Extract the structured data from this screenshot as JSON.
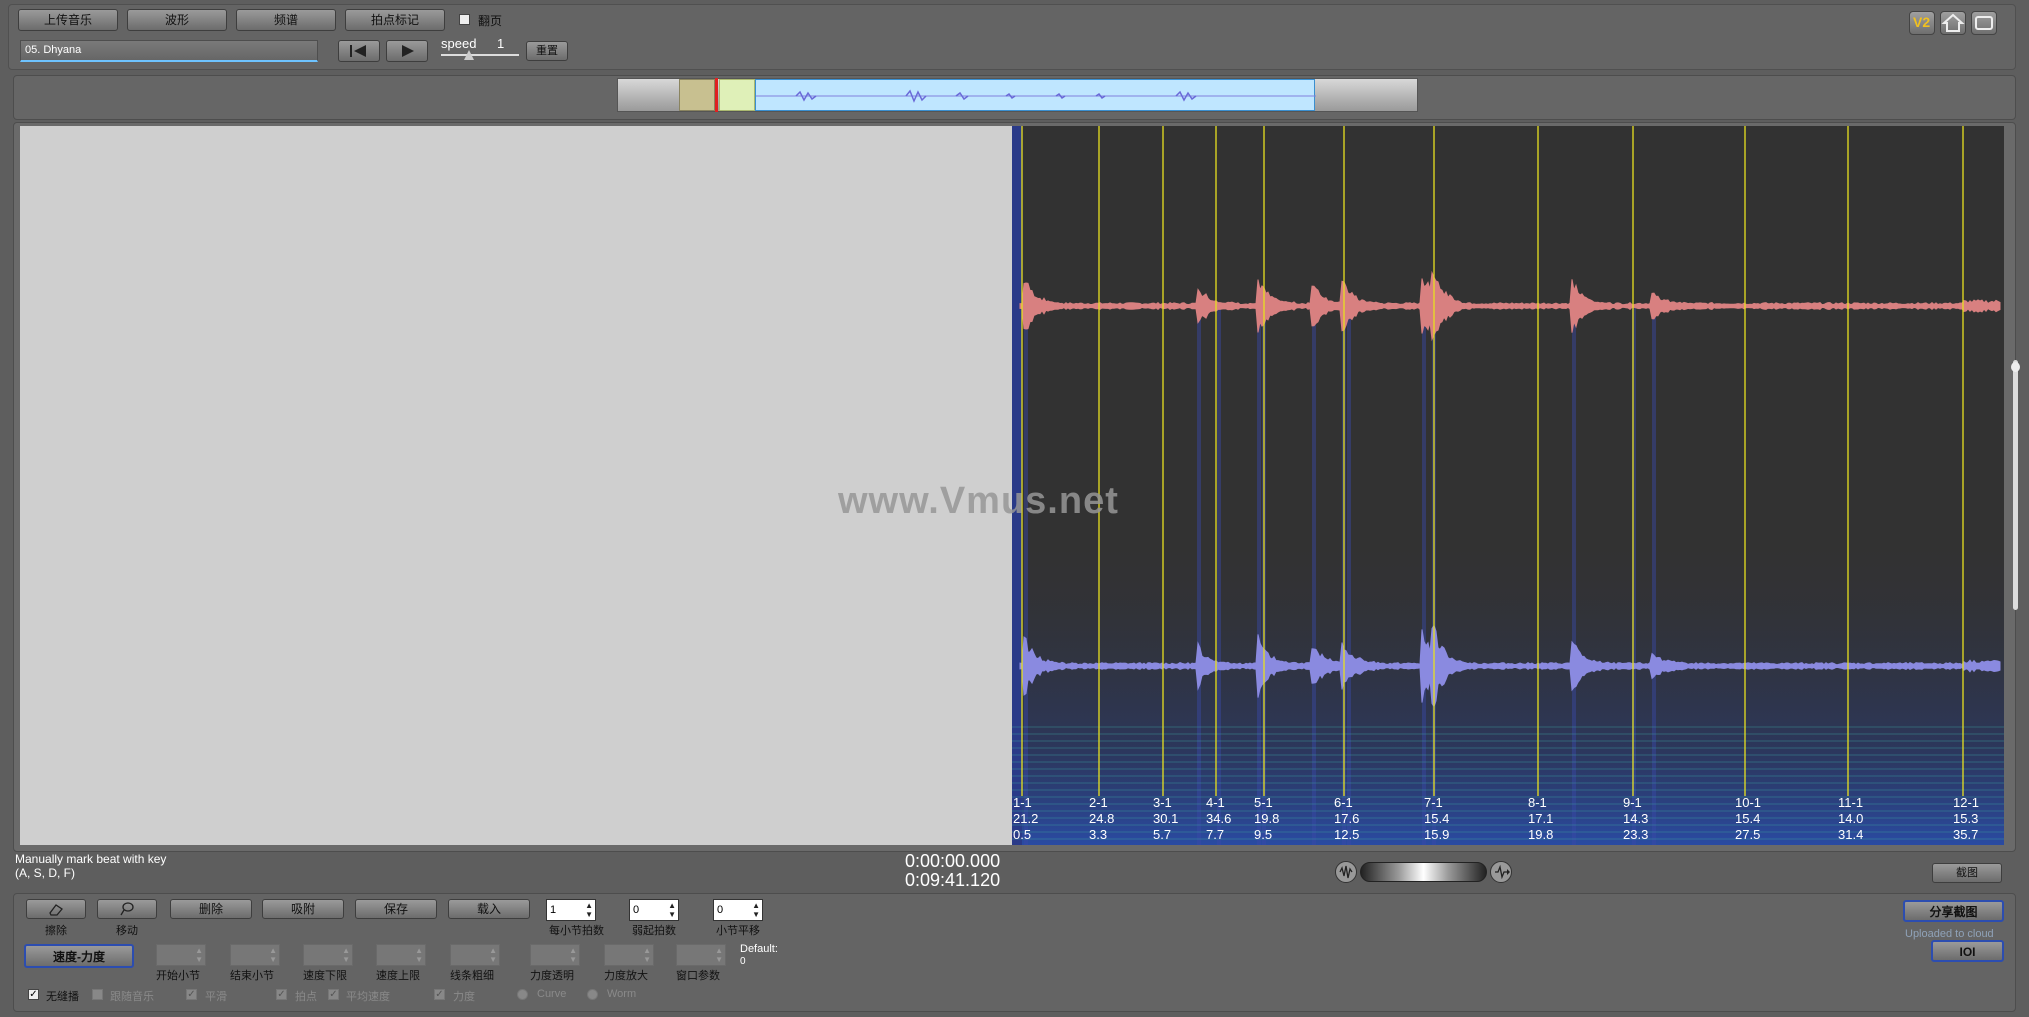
{
  "toolbar": {
    "upload_music": "上传音乐",
    "waveform": "波形",
    "spectrum": "频谱",
    "beat_mark": "拍点标记",
    "page_turn_label": "翻页",
    "track_name": "05. Dhyana",
    "speed_label": "speed",
    "speed_value": "1",
    "reset": "重置"
  },
  "top_right_icons": [
    "v2-icon",
    "home-icon",
    "window-icon"
  ],
  "top_right_v2": "V2",
  "main": {
    "watermark": "www.Vmus.net",
    "markers": [
      {
        "bar": "1-1",
        "tempo": "21.2",
        "time": "0.5"
      },
      {
        "bar": "2-1",
        "tempo": "24.8",
        "time": "3.3"
      },
      {
        "bar": "3-1",
        "tempo": "30.1",
        "time": "5.7"
      },
      {
        "bar": "4-1",
        "tempo": "34.6",
        "time": "7.7"
      },
      {
        "bar": "5-1",
        "tempo": "19.8",
        "time": "9.5"
      },
      {
        "bar": "6-1",
        "tempo": "17.6",
        "time": "12.5"
      },
      {
        "bar": "7-1",
        "tempo": "15.4",
        "time": "15.9"
      },
      {
        "bar": "8-1",
        "tempo": "17.1",
        "time": "19.8"
      },
      {
        "bar": "9-1",
        "tempo": "14.3",
        "time": "23.3"
      },
      {
        "bar": "10-1",
        "tempo": "15.4",
        "time": "27.5"
      },
      {
        "bar": "11-1",
        "tempo": "14.0",
        "time": "31.4"
      },
      {
        "bar": "12-1",
        "tempo": "15.3",
        "time": "35.7"
      }
    ]
  },
  "status": {
    "hint_line1": "Manually mark beat with key",
    "hint_line2": "(A, S, D, F)",
    "current_time": "0:00:00.000",
    "total_time": "0:09:41.120",
    "screenshot": "截图"
  },
  "bottom": {
    "erase_label": "擦除",
    "move_label": "移动",
    "delete": "删除",
    "snap": "吸附",
    "save": "保存",
    "load": "载入",
    "beats_per_bar_label": "每小节拍数",
    "beats_per_bar_value": "1",
    "pickup_beats_label": "弱起拍数",
    "pickup_beats_value": "0",
    "bar_shift_label": "小节平移",
    "bar_shift_value": "0",
    "tempo_dynamics": "速度-力度",
    "start_bar": "开始小节",
    "end_bar": "结束小节",
    "tempo_lower": "速度下限",
    "tempo_upper": "速度上限",
    "line_thickness": "线条粗细",
    "dynamics_transparency": "力度透明",
    "dynamics_zoom": "力度放大",
    "window_param": "窗口参数",
    "default_label": "Default:",
    "default_value": "0",
    "share_screenshot": "分享截图",
    "uploaded_to_cloud": "Uploaded to cloud",
    "ioi": "IOI",
    "opt_metronome": "无缝播",
    "opt_follow_music": "跟随音乐",
    "opt_smooth": "平滑",
    "opt_beat": "拍点",
    "opt_avg_tempo": "平均速度",
    "opt_dynamics": "力度",
    "opt_curve": "Curve",
    "opt_worm": "Worm"
  }
}
